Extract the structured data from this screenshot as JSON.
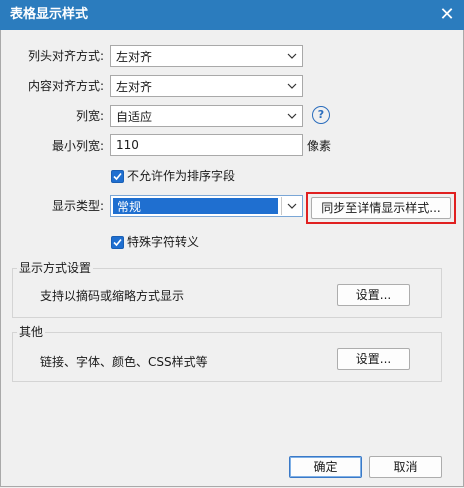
{
  "dialog": {
    "title": "表格显示样式"
  },
  "form": {
    "header_align": {
      "label": "列头对齐方式:",
      "value": "左对齐"
    },
    "content_align": {
      "label": "内容对齐方式:",
      "value": "左对齐"
    },
    "column_width": {
      "label": "列宽:",
      "value": "自适应"
    },
    "min_width": {
      "label": "最小列宽:",
      "value": "110",
      "unit": "像素"
    },
    "no_sort": {
      "label": "不允许作为排序字段",
      "checked": true
    },
    "display_type": {
      "label": "显示类型:",
      "value": "常规"
    },
    "sync_button": "同步至详情显示样式...",
    "special_escape": {
      "label": "特殊字符转义",
      "checked": true
    }
  },
  "display_mode_group": {
    "title": "显示方式设置",
    "description": "支持以摘码或缩略方式显示",
    "button": "设置..."
  },
  "other_group": {
    "title": "其他",
    "description": "链接、字体、颜色、CSS样式等",
    "button": "设置..."
  },
  "footer": {
    "ok": "确定",
    "cancel": "取消"
  },
  "colors": {
    "titlebar": "#2b7cbe",
    "selection": "#1f6fd0",
    "highlight_border": "#e02020"
  }
}
